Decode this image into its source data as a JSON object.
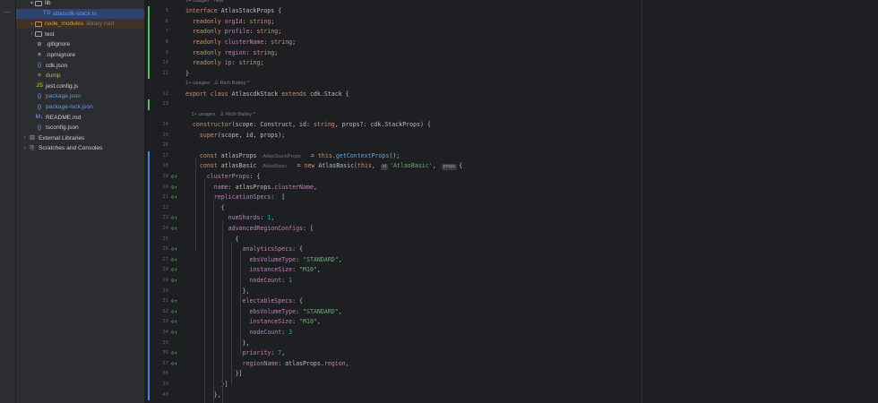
{
  "toolstrip": {
    "more": "⋯"
  },
  "tree": [
    {
      "indent": 2,
      "twisty": "▾",
      "icon": "folder",
      "label": "lib",
      "style": "",
      "suffix": ""
    },
    {
      "indent": 4,
      "twisty": "",
      "icon": "ts",
      "label": "atlascdk-stack.ts",
      "style": "blue",
      "suffix": "",
      "selected": true
    },
    {
      "indent": 2,
      "twisty": "›",
      "icon": "folder-orange",
      "label": "node_modules",
      "style": "orange",
      "suffix": "library root",
      "excluded": true
    },
    {
      "indent": 2,
      "twisty": "›",
      "icon": "folder",
      "label": "test",
      "style": "",
      "suffix": ""
    },
    {
      "indent": 2,
      "twisty": "",
      "icon": "gitignore",
      "label": ".gitignore",
      "style": "",
      "suffix": ""
    },
    {
      "indent": 2,
      "twisty": "",
      "icon": "npmignore",
      "label": ".npmignore",
      "style": "",
      "suffix": ""
    },
    {
      "indent": 2,
      "twisty": "",
      "icon": "json",
      "label": "cdk.json",
      "style": "",
      "suffix": ""
    },
    {
      "indent": 2,
      "twisty": "",
      "icon": "text",
      "label": "dump",
      "style": "yellow",
      "suffix": ""
    },
    {
      "indent": 2,
      "twisty": "",
      "icon": "js",
      "label": "jest.config.js",
      "style": "",
      "suffix": ""
    },
    {
      "indent": 2,
      "twisty": "",
      "icon": "json",
      "label": "package.json",
      "style": "blue",
      "suffix": ""
    },
    {
      "indent": 2,
      "twisty": "",
      "icon": "json",
      "label": "package-lock.json",
      "style": "blue",
      "suffix": ""
    },
    {
      "indent": 2,
      "twisty": "",
      "icon": "md",
      "label": "README.md",
      "style": "",
      "suffix": ""
    },
    {
      "indent": 2,
      "twisty": "",
      "icon": "json",
      "label": "tsconfig.json",
      "style": "",
      "suffix": ""
    },
    {
      "indent": 0,
      "twisty": "›",
      "icon": "library",
      "label": "External Libraries",
      "style": "",
      "suffix": ""
    },
    {
      "indent": 0,
      "twisty": "›",
      "icon": "scratch",
      "label": "Scratches and Consoles",
      "style": "",
      "suffix": ""
    }
  ],
  "icons": {
    "folder": "folder-icon",
    "ts": "typescript-file-icon",
    "gitignore": "ignore-file-icon",
    "npmignore": "list-file-icon",
    "json": "json-file-icon",
    "text": "text-file-icon",
    "js": "javascript-file-icon",
    "md": "markdown-file-icon",
    "library": "library-icon",
    "scratch": "scratches-icon"
  },
  "editor": {
    "lines": [
      {
        "kind": "hint",
        "text": "1+ usages   new *"
      },
      {
        "kind": "code",
        "n": "5",
        "mark": "green",
        "html": [
          [
            "kw",
            "interface "
          ],
          [
            "",
            "AtlasStackProps {"
          ]
        ]
      },
      {
        "kind": "code",
        "n": "6",
        "mark": "green",
        "html": [
          [
            "",
            "  "
          ],
          [
            "kw",
            "readonly "
          ],
          [
            "prop",
            "orgId"
          ],
          [
            "",
            ": "
          ],
          [
            "kw",
            "string"
          ],
          [
            "",
            ";"
          ]
        ]
      },
      {
        "kind": "code",
        "n": "7",
        "mark": "green",
        "html": [
          [
            "",
            "  "
          ],
          [
            "kw",
            "readonly "
          ],
          [
            "prop",
            "profile"
          ],
          [
            "",
            ": "
          ],
          [
            "kw",
            "string"
          ],
          [
            "",
            ";"
          ]
        ]
      },
      {
        "kind": "code",
        "n": "8",
        "mark": "green",
        "html": [
          [
            "",
            "  "
          ],
          [
            "kw",
            "readonly "
          ],
          [
            "prop",
            "clusterName"
          ],
          [
            "",
            ": "
          ],
          [
            "kw",
            "string"
          ],
          [
            "",
            ";"
          ]
        ]
      },
      {
        "kind": "code",
        "n": "9",
        "mark": "green",
        "html": [
          [
            "",
            "  "
          ],
          [
            "kw",
            "readonly "
          ],
          [
            "prop",
            "region"
          ],
          [
            "",
            ": "
          ],
          [
            "kw",
            "string"
          ],
          [
            "",
            ";"
          ]
        ]
      },
      {
        "kind": "code",
        "n": "10",
        "mark": "green",
        "html": [
          [
            "",
            "  "
          ],
          [
            "kw",
            "readonly "
          ],
          [
            "prop",
            "ip"
          ],
          [
            "",
            ": "
          ],
          [
            "kw",
            "string"
          ],
          [
            "",
            ";"
          ]
        ]
      },
      {
        "kind": "code",
        "n": "11",
        "mark": "green",
        "html": [
          [
            "",
            "}"
          ]
        ]
      },
      {
        "kind": "hint",
        "text": "1+ usages   ♙ Rich Bailey *"
      },
      {
        "kind": "code",
        "n": "12",
        "mark": "",
        "html": [
          [
            "kw",
            "export class "
          ],
          [
            "",
            "AtlascdkStack "
          ],
          [
            "kw",
            "extends "
          ],
          [
            "",
            "cdk.Stack {"
          ]
        ]
      },
      {
        "kind": "code",
        "n": "13",
        "mark": "green",
        "html": [
          [
            "",
            ""
          ]
        ]
      },
      {
        "kind": "hint",
        "text": "    1+ usages   ♙ Rich Bailey *"
      },
      {
        "kind": "code",
        "n": "14",
        "mark": "",
        "html": [
          [
            "",
            "  "
          ],
          [
            "kw",
            "constructor"
          ],
          [
            "",
            "(scope: Construct, id: "
          ],
          [
            "kw",
            "string"
          ],
          [
            "",
            ", props?: cdk.StackProps) {"
          ]
        ]
      },
      {
        "kind": "code",
        "n": "15",
        "mark": "",
        "html": [
          [
            "",
            "    "
          ],
          [
            "kw",
            "super"
          ],
          [
            "",
            "(scope, id, props);"
          ]
        ]
      },
      {
        "kind": "code",
        "n": "16",
        "mark": "",
        "html": [
          [
            "",
            ""
          ]
        ]
      },
      {
        "kind": "code",
        "n": "17",
        "mark": "blue",
        "html": [
          [
            "",
            "    "
          ],
          [
            "kw",
            "const "
          ],
          [
            "",
            "atlasProps "
          ],
          [
            "typeh",
            ": AtlasStackProps  "
          ],
          [
            "",
            "  = "
          ],
          [
            "kw",
            "this"
          ],
          [
            "",
            "."
          ],
          [
            "fn",
            "getContextProps"
          ],
          [
            "",
            "();"
          ]
        ]
      },
      {
        "kind": "code",
        "n": "18",
        "mark": "blue",
        "html": [
          [
            "",
            "    "
          ],
          [
            "kw",
            "const "
          ],
          [
            "",
            "atlasBasic "
          ],
          [
            "typeh",
            ": AtlasBasic  "
          ],
          [
            "",
            "  = "
          ],
          [
            "kw",
            "new "
          ],
          [
            "",
            "AtlasBasic("
          ],
          [
            "kw",
            "this"
          ],
          [
            "",
            ", "
          ],
          [
            "chip",
            "id"
          ],
          [
            "str",
            "'AtlasBasic'"
          ],
          [
            "",
            ", "
          ],
          [
            "chip",
            "props"
          ],
          [
            "",
            "{"
          ]
        ]
      },
      {
        "kind": "code",
        "n": "19",
        "mark": "blue",
        "gicon": true,
        "html": [
          [
            "",
            "      "
          ],
          [
            "prop",
            "clusterProps"
          ],
          [
            "",
            ": {"
          ]
        ]
      },
      {
        "kind": "code",
        "n": "20",
        "mark": "blue",
        "gicon": true,
        "html": [
          [
            "",
            "        "
          ],
          [
            "prop",
            "name"
          ],
          [
            "",
            ": atlasProps."
          ],
          [
            "prop",
            "clusterName"
          ],
          [
            "",
            ","
          ]
        ]
      },
      {
        "kind": "code",
        "n": "21",
        "mark": "blue",
        "gicon": true,
        "html": [
          [
            "",
            "        "
          ],
          [
            "prop",
            "replicationSpecs"
          ],
          [
            "",
            ":  ["
          ]
        ]
      },
      {
        "kind": "code",
        "n": "22",
        "mark": "blue",
        "html": [
          [
            "",
            "          {"
          ]
        ]
      },
      {
        "kind": "code",
        "n": "23",
        "mark": "blue",
        "gicon": true,
        "html": [
          [
            "",
            "            "
          ],
          [
            "prop",
            "numShards"
          ],
          [
            "",
            ": "
          ],
          [
            "num",
            "1"
          ],
          [
            "",
            ","
          ]
        ]
      },
      {
        "kind": "code",
        "n": "24",
        "mark": "blue",
        "gicon": true,
        "html": [
          [
            "",
            "            "
          ],
          [
            "prop",
            "advancedRegionConfigs"
          ],
          [
            "",
            ": ["
          ]
        ]
      },
      {
        "kind": "code",
        "n": "25",
        "mark": "blue",
        "html": [
          [
            "",
            "              {"
          ]
        ]
      },
      {
        "kind": "code",
        "n": "26",
        "mark": "blue",
        "gicon": true,
        "html": [
          [
            "",
            "                "
          ],
          [
            "prop",
            "analyticsSpecs"
          ],
          [
            "",
            ": {"
          ]
        ]
      },
      {
        "kind": "code",
        "n": "27",
        "mark": "blue",
        "gicon": true,
        "html": [
          [
            "",
            "                  "
          ],
          [
            "prop",
            "ebsVolumeType"
          ],
          [
            "",
            ": "
          ],
          [
            "str",
            "\"STANDARD\""
          ],
          [
            "",
            ","
          ]
        ]
      },
      {
        "kind": "code",
        "n": "28",
        "mark": "blue",
        "gicon": true,
        "html": [
          [
            "",
            "                  "
          ],
          [
            "prop",
            "instanceSize"
          ],
          [
            "",
            ": "
          ],
          [
            "str",
            "\"M10\""
          ],
          [
            "",
            ","
          ]
        ]
      },
      {
        "kind": "code",
        "n": "29",
        "mark": "blue",
        "gicon": true,
        "html": [
          [
            "",
            "                  "
          ],
          [
            "prop",
            "nodeCount"
          ],
          [
            "",
            ": "
          ],
          [
            "num",
            "1"
          ]
        ]
      },
      {
        "kind": "code",
        "n": "30",
        "mark": "blue",
        "html": [
          [
            "",
            "                },"
          ]
        ]
      },
      {
        "kind": "code",
        "n": "31",
        "mark": "blue",
        "gicon": true,
        "html": [
          [
            "",
            "                "
          ],
          [
            "prop",
            "electableSpecs"
          ],
          [
            "",
            ": {"
          ]
        ]
      },
      {
        "kind": "code",
        "n": "32",
        "mark": "blue",
        "gicon": true,
        "html": [
          [
            "",
            "                  "
          ],
          [
            "prop",
            "ebsVolumeType"
          ],
          [
            "",
            ": "
          ],
          [
            "str",
            "\"STANDARD\""
          ],
          [
            "",
            ","
          ]
        ]
      },
      {
        "kind": "code",
        "n": "33",
        "mark": "blue",
        "gicon": true,
        "html": [
          [
            "",
            "                  "
          ],
          [
            "prop",
            "instanceSize"
          ],
          [
            "",
            ": "
          ],
          [
            "str",
            "\"M10\""
          ],
          [
            "",
            ","
          ]
        ]
      },
      {
        "kind": "code",
        "n": "34",
        "mark": "blue",
        "gicon": true,
        "html": [
          [
            "",
            "                  "
          ],
          [
            "prop",
            "nodeCount"
          ],
          [
            "",
            ": "
          ],
          [
            "num",
            "3"
          ]
        ]
      },
      {
        "kind": "code",
        "n": "35",
        "mark": "blue",
        "html": [
          [
            "",
            "                },"
          ]
        ]
      },
      {
        "kind": "code",
        "n": "36",
        "mark": "blue",
        "gicon": true,
        "html": [
          [
            "",
            "                "
          ],
          [
            "prop",
            "priority"
          ],
          [
            "",
            ": "
          ],
          [
            "num",
            "7"
          ],
          [
            "",
            ","
          ]
        ]
      },
      {
        "kind": "code",
        "n": "37",
        "mark": "blue",
        "gicon": true,
        "html": [
          [
            "",
            "                "
          ],
          [
            "prop",
            "regionName"
          ],
          [
            "",
            ": atlasProps."
          ],
          [
            "prop",
            "region"
          ],
          [
            "",
            ","
          ]
        ]
      },
      {
        "kind": "code",
        "n": "38",
        "mark": "blue",
        "html": [
          [
            "",
            "              }]"
          ]
        ]
      },
      {
        "kind": "code",
        "n": "39",
        "mark": "blue",
        "html": [
          [
            "",
            "          }]"
          ]
        ]
      },
      {
        "kind": "code",
        "n": "40",
        "mark": "blue",
        "html": [
          [
            "",
            "        },"
          ]
        ]
      }
    ]
  },
  "colors": {
    "added": "#5fb865",
    "modified": "#4d7ed6",
    "selection": "#2e436e"
  }
}
